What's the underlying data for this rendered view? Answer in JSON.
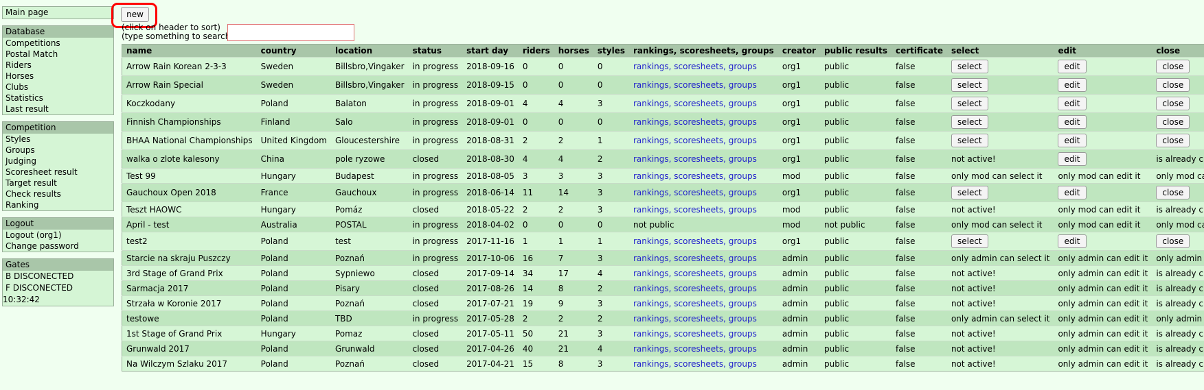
{
  "sidebar": {
    "main_page": "Main page",
    "database": {
      "title": "Database",
      "items": [
        "Competitions",
        "Postal Match",
        "Riders",
        "Horses",
        "Clubs",
        "Statistics",
        "Last result"
      ]
    },
    "competition": {
      "title": "Competition",
      "items": [
        "Styles",
        "Groups",
        "Judging",
        "Scoresheet result",
        "Target result",
        "Check results",
        "Ranking"
      ]
    },
    "logout": {
      "title": "Logout",
      "items": [
        "Logout (org1)",
        "Change password"
      ]
    },
    "gates": {
      "title": "Gates",
      "lines": [
        "B DISCONECTED",
        "F DISCONECTED",
        "10:32:42"
      ]
    }
  },
  "toolbar": {
    "new_label": "new",
    "hint_line1": "(click on header to sort)",
    "hint_line2": "(type something to search)",
    "search_value": ""
  },
  "table": {
    "headers": [
      "name",
      "country",
      "location",
      "status",
      "start day",
      "riders",
      "horses",
      "styles",
      "rankings, scoresheets, groups",
      "creator",
      "public results",
      "certificate",
      "select",
      "edit",
      "close"
    ],
    "rows": [
      {
        "name": "Arrow Rain Korean 2-3-3",
        "country": "Sweden",
        "location": "Billsbro,Vingaker",
        "status": "in progress",
        "start": "2018-09-16",
        "riders": "0",
        "horses": "0",
        "styles": "0",
        "links": "rankings, scoresheets, groups",
        "creator": "org1",
        "public": "public",
        "certificate": "false",
        "select": "select",
        "edit": "edit",
        "close": "close"
      },
      {
        "name": "Arrow Rain Special",
        "country": "Sweden",
        "location": "Billsbro,Vingaker",
        "status": "in progress",
        "start": "2018-09-15",
        "riders": "0",
        "horses": "0",
        "styles": "0",
        "links": "rankings, scoresheets, groups",
        "creator": "org1",
        "public": "public",
        "certificate": "false",
        "select": "select",
        "edit": "edit",
        "close": "close"
      },
      {
        "name": "Koczkodany",
        "country": "Poland",
        "location": "Balaton",
        "status": "in progress",
        "start": "2018-09-01",
        "riders": "4",
        "horses": "4",
        "styles": "3",
        "links": "rankings, scoresheets, groups",
        "creator": "org1",
        "public": "public",
        "certificate": "false",
        "select": "select",
        "edit": "edit",
        "close": "close"
      },
      {
        "name": "Finnish Championships",
        "country": "Finland",
        "location": "Salo",
        "status": "in progress",
        "start": "2018-09-01",
        "riders": "0",
        "horses": "0",
        "styles": "0",
        "links": "rankings, scoresheets, groups",
        "creator": "org1",
        "public": "public",
        "certificate": "false",
        "select": "select",
        "edit": "edit",
        "close": "close"
      },
      {
        "name": "BHAA National Championships",
        "country": "United Kingdom",
        "location": "Gloucestershire",
        "status": "in progress",
        "start": "2018-08-31",
        "riders": "2",
        "horses": "2",
        "styles": "1",
        "links": "rankings, scoresheets, groups",
        "creator": "org1",
        "public": "public",
        "certificate": "false",
        "select": "select",
        "edit": "edit",
        "close": "close"
      },
      {
        "name": "walka o zlote kalesony",
        "country": "China",
        "location": "pole ryzowe",
        "status": "closed",
        "start": "2018-08-30",
        "riders": "4",
        "horses": "4",
        "styles": "2",
        "links": "rankings, scoresheets, groups",
        "creator": "org1",
        "public": "public",
        "certificate": "false",
        "select_text": "not active!",
        "edit": "edit",
        "close_text": "is already closed"
      },
      {
        "name": "Test 99",
        "country": "Hungary",
        "location": "Budapest",
        "status": "in progress",
        "start": "2018-08-05",
        "riders": "3",
        "horses": "3",
        "styles": "3",
        "links": "rankings, scoresheets, groups",
        "creator": "mod",
        "public": "public",
        "certificate": "false",
        "select_text": "only mod can select it",
        "edit_text": "only mod can edit it",
        "close_text": "only mod can close it"
      },
      {
        "name": "Gauchoux Open 2018",
        "country": "France",
        "location": "Gauchoux",
        "status": "in progress",
        "start": "2018-06-14",
        "riders": "11",
        "horses": "14",
        "styles": "3",
        "links": "rankings, scoresheets, groups",
        "creator": "org1",
        "public": "public",
        "certificate": "false",
        "select": "select",
        "edit": "edit",
        "close": "close"
      },
      {
        "name": "Teszt HAOWC",
        "country": "Hungary",
        "location": "Pomáz",
        "status": "closed",
        "start": "2018-05-22",
        "riders": "2",
        "horses": "2",
        "styles": "3",
        "links": "rankings, scoresheets, groups",
        "creator": "mod",
        "public": "public",
        "certificate": "false",
        "select_text": "not active!",
        "edit_text": "only mod can edit it",
        "close_text": "is already closed"
      },
      {
        "name": "April - test",
        "country": "Australia",
        "location": "POSTAL",
        "status": "in progress",
        "start": "2018-04-02",
        "riders": "0",
        "horses": "0",
        "styles": "0",
        "links_text": "not public",
        "creator": "mod",
        "public": "not public",
        "certificate": "false",
        "select_text": "only mod can select it",
        "edit_text": "only mod can edit it",
        "close_text": "only mod can close it"
      },
      {
        "name": "test2",
        "country": "Poland",
        "location": "test",
        "status": "in progress",
        "start": "2017-11-16",
        "riders": "1",
        "horses": "1",
        "styles": "1",
        "links": "rankings, scoresheets, groups",
        "creator": "org1",
        "public": "public",
        "certificate": "false",
        "select": "select",
        "edit": "edit",
        "close": "close"
      },
      {
        "name": "Starcie na skraju Puszczy",
        "country": "Poland",
        "location": "Poznań",
        "status": "in progress",
        "start": "2017-10-06",
        "riders": "16",
        "horses": "7",
        "styles": "3",
        "links": "rankings, scoresheets, groups",
        "creator": "admin",
        "public": "public",
        "certificate": "false",
        "select_text": "only admin can select it",
        "edit_text": "only admin can edit it",
        "close_text": "only admin can close it"
      },
      {
        "name": "3rd Stage of Grand Prix",
        "country": "Poland",
        "location": "Sypniewo",
        "status": "closed",
        "start": "2017-09-14",
        "riders": "34",
        "horses": "17",
        "styles": "4",
        "links": "rankings, scoresheets, groups",
        "creator": "admin",
        "public": "public",
        "certificate": "false",
        "select_text": "not active!",
        "edit_text": "only admin can edit it",
        "close_text": "is already closed"
      },
      {
        "name": "Sarmacja 2017",
        "country": "Poland",
        "location": "Pisary",
        "status": "closed",
        "start": "2017-08-26",
        "riders": "14",
        "horses": "8",
        "styles": "2",
        "links": "rankings, scoresheets, groups",
        "creator": "admin",
        "public": "public",
        "certificate": "false",
        "select_text": "not active!",
        "edit_text": "only admin can edit it",
        "close_text": "is already closed"
      },
      {
        "name": "Strzała w Koronie 2017",
        "country": "Poland",
        "location": "Poznań",
        "status": "closed",
        "start": "2017-07-21",
        "riders": "19",
        "horses": "9",
        "styles": "3",
        "links": "rankings, scoresheets, groups",
        "creator": "admin",
        "public": "public",
        "certificate": "false",
        "select_text": "not active!",
        "edit_text": "only admin can edit it",
        "close_text": "is already closed"
      },
      {
        "name": "testowe",
        "country": "Poland",
        "location": "TBD",
        "status": "in progress",
        "start": "2017-05-28",
        "riders": "2",
        "horses": "2",
        "styles": "2",
        "links": "rankings, scoresheets, groups",
        "creator": "admin",
        "public": "public",
        "certificate": "false",
        "select_text": "only admin can select it",
        "edit_text": "only admin can edit it",
        "close_text": "only admin can close it"
      },
      {
        "name": "1st Stage of Grand Prix",
        "country": "Hungary",
        "location": "Pomaz",
        "status": "closed",
        "start": "2017-05-11",
        "riders": "50",
        "horses": "21",
        "styles": "3",
        "links": "rankings, scoresheets, groups",
        "creator": "admin",
        "public": "public",
        "certificate": "false",
        "select_text": "not active!",
        "edit_text": "only admin can edit it",
        "close_text": "is already closed"
      },
      {
        "name": "Grunwald 2017",
        "country": "Poland",
        "location": "Grunwald",
        "status": "closed",
        "start": "2017-04-26",
        "riders": "40",
        "horses": "21",
        "styles": "4",
        "links": "rankings, scoresheets, groups",
        "creator": "admin",
        "public": "public",
        "certificate": "false",
        "select_text": "not active!",
        "edit_text": "only admin can edit it",
        "close_text": "is already closed"
      },
      {
        "name": "Na Wilczym Szlaku 2017",
        "country": "Poland",
        "location": "Poznań",
        "status": "closed",
        "start": "2017-04-21",
        "riders": "15",
        "horses": "8",
        "styles": "3",
        "links": "rankings, scoresheets, groups",
        "creator": "admin",
        "public": "public",
        "certificate": "false",
        "select_text": "not active!",
        "edit_text": "only admin can edit it",
        "close_text": "is already closed"
      }
    ]
  }
}
